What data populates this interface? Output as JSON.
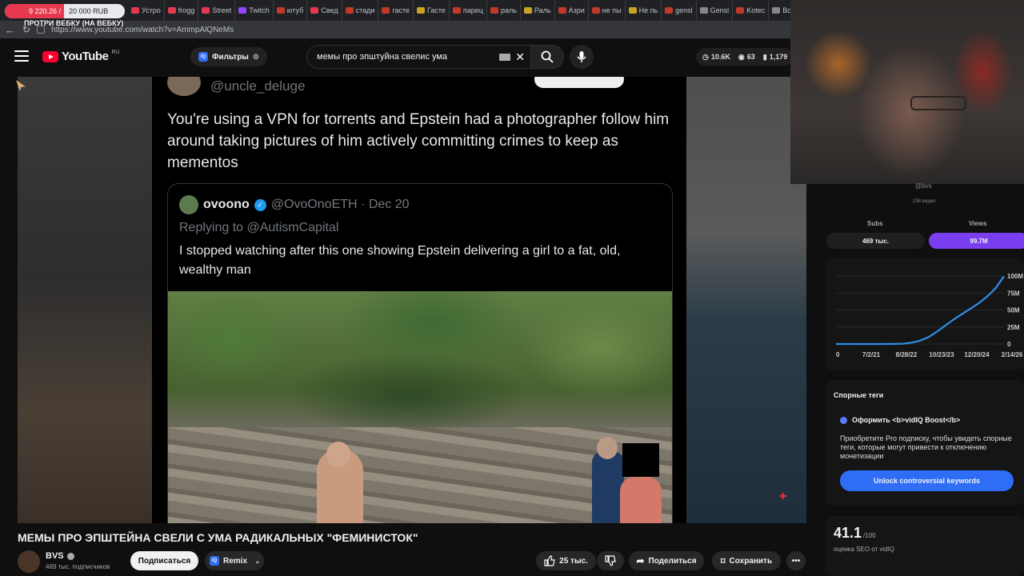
{
  "browser": {
    "donation": {
      "left": "9 220.26 /",
      "right": "20 000 RUB"
    },
    "tabs": [
      {
        "label": "Устро",
        "color": "#e53950"
      },
      {
        "label": "frogg",
        "color": "#e53950"
      },
      {
        "label": "Street",
        "color": "#e53950"
      },
      {
        "label": "Twitch",
        "color": "#9146ff"
      },
      {
        "label": "ютуб",
        "color": "#c0392b"
      },
      {
        "label": "Свед",
        "color": "#e53950"
      },
      {
        "label": "стади",
        "color": "#c0392b"
      },
      {
        "label": "гасте",
        "color": "#c0392b"
      },
      {
        "label": "Гасте",
        "color": "#c9a227"
      },
      {
        "label": "парец",
        "color": "#c0392b"
      },
      {
        "label": "раль",
        "color": "#c0392b"
      },
      {
        "label": "Раль",
        "color": "#c9a227"
      },
      {
        "label": "Азри",
        "color": "#c0392b"
      },
      {
        "label": "не пы",
        "color": "#c0392b"
      },
      {
        "label": "Не пь",
        "color": "#c9a227"
      },
      {
        "label": "gensl",
        "color": "#c0392b"
      },
      {
        "label": "Gensl",
        "color": "#888888"
      },
      {
        "label": "Kotec",
        "color": "#c0392b"
      },
      {
        "label": "Bo",
        "color": "#888888"
      }
    ],
    "overlay_label": "ПРОТРИ ВЕБКУ (НА ВЕБКУ)",
    "url": "https://www.youtube.com/watch?v=AmmpAlQNeMs"
  },
  "header": {
    "logo_text": "YouTube",
    "logo_region": "RU",
    "filters_label": "Фильтры",
    "search_value": "мемы про эпштуйна свелис ума",
    "stats": {
      "left": "10.6K",
      "mid": "63",
      "right": "1,179"
    }
  },
  "video": {
    "tweet": {
      "top_handle": "@uncle_deluge",
      "text": "You're using a VPN for torrents and Epstein had a photographer follow him around taking pictures of him actively committing crimes to keep as mementos",
      "quote": {
        "name": "ovoono",
        "handle": "@OvoOnoETH · Dec 20",
        "replying": "Replying to @AutismCapital",
        "text": "I stopped watching after this one showing Epstein delivering a girl to a fat, old, wealthy man"
      }
    }
  },
  "meta": {
    "title": "МЕМЫ ПРО ЭПШТЕЙНА СВЕЛИ С УМА РАДИКАЛЬНЫХ \"ФЕМИНИСТОК\"",
    "channel": "BVS",
    "subscribers": "469 тыс. подписчиков",
    "subscribe_label": "Подписаться",
    "remix_label": "Remix",
    "likes": "25 тыс.",
    "share_label": "Поделиться",
    "save_label": "Сохранить"
  },
  "sidebar": {
    "handle": "@bvs",
    "videos": "238 видео",
    "subs_label": "Subs",
    "views_label": "Views",
    "subs_value": "469 тыс.",
    "views_value": "99.7M",
    "tags_title": "Спорные теги",
    "boost_label": "Оформить <b>vidIQ Boost</b>",
    "boost_desc": "Приобретите Pro подписку, чтобы увидеть спорные теги, которые могут привести к отключению монетизации",
    "unlock_label": "Unlock controversial keywords",
    "seo_value": "41.1",
    "seo_of": "/100",
    "seo_label": "оценка SEO от vidIQ",
    "accent": "#7b3ff2",
    "line_color": "#2f8fe8"
  },
  "chart_data": {
    "type": "line",
    "title": "",
    "xlabel": "",
    "ylabel": "",
    "x_ticks": [
      "0",
      "7/2/21",
      "8/28/22",
      "10/23/23",
      "12/20/24",
      "2/14/26"
    ],
    "y_ticks": [
      "0",
      "25M",
      "50M",
      "75M",
      "100M"
    ],
    "ylim": [
      0,
      100
    ],
    "series": [
      {
        "x": [
          0,
          0.1,
          0.2,
          0.3,
          0.4,
          0.45,
          0.5,
          0.55,
          0.6,
          0.65,
          0.7,
          0.75,
          0.8,
          0.85,
          0.9,
          0.95,
          1.0
        ],
        "values": [
          0,
          0,
          0,
          0,
          0.5,
          2,
          5,
          10,
          18,
          27,
          36,
          44,
          52,
          60,
          70,
          82,
          99.7
        ]
      }
    ]
  }
}
